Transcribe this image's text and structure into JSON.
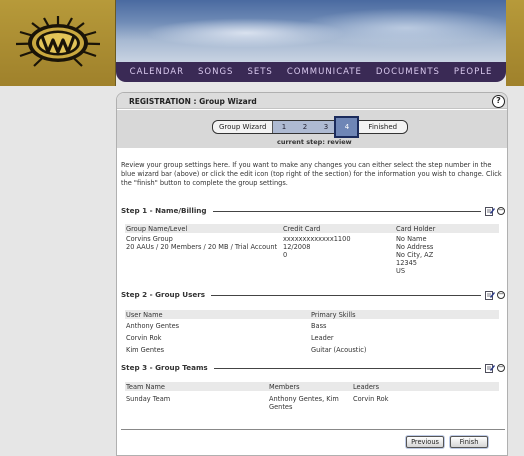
{
  "nav": [
    "CALENDAR",
    "SONGS",
    "SETS",
    "COMMUNICATE",
    "DOCUMENTS",
    "PEOPLE"
  ],
  "panel": {
    "title": "REGISTRATION : Group Wizard",
    "help": "?"
  },
  "wizard": {
    "label": "Group Wizard",
    "steps": [
      "1",
      "2",
      "3",
      "4"
    ],
    "active_step": "4",
    "finished": "Finished",
    "current_step": "current step: review"
  },
  "intro": "Review your group settings here. If you want to make any changes you can either select the step number in the blue wizard bar (above) or click the edit icon (top right of the section) for the information you wish to change. Click the \"finish\" button to complete the group settings.",
  "step1": {
    "title": "Step 1 - Name/Billing",
    "headers": [
      "Group Name/Level",
      "Credit Card",
      "Card Holder"
    ],
    "col1": [
      "Corvins Group",
      "20 AAUs / 20 Members / 20 MB / Trial Account"
    ],
    "col2": [
      "xxxxxxxxxxxxx1100",
      "12/2008",
      "0"
    ],
    "col3": [
      "No Name",
      "No Address",
      "No City, AZ",
      "12345",
      "US"
    ]
  },
  "step2": {
    "title": "Step 2 - Group Users",
    "headers": [
      "User Name",
      "Primary Skills"
    ],
    "rows": [
      [
        "Anthony Gentes",
        "Bass"
      ],
      [
        "Corvin Rok",
        "Leader"
      ],
      [
        "Kim Gentes",
        "Guitar (Acoustic)"
      ]
    ]
  },
  "step3": {
    "title": "Step 3 - Group Teams",
    "headers": [
      "Team Name",
      "Members",
      "Leaders"
    ],
    "rows": [
      [
        "Sunday Team",
        "Anthony Gentes, Kim",
        "Gentes",
        "Corvin Rok"
      ]
    ]
  },
  "buttons": {
    "previous": "Previous",
    "finish": "Finish"
  },
  "colors": {
    "nav_bg": "#3a2a55",
    "logo_gold": "#a8892d",
    "wizard_active": "#6f86b6"
  }
}
